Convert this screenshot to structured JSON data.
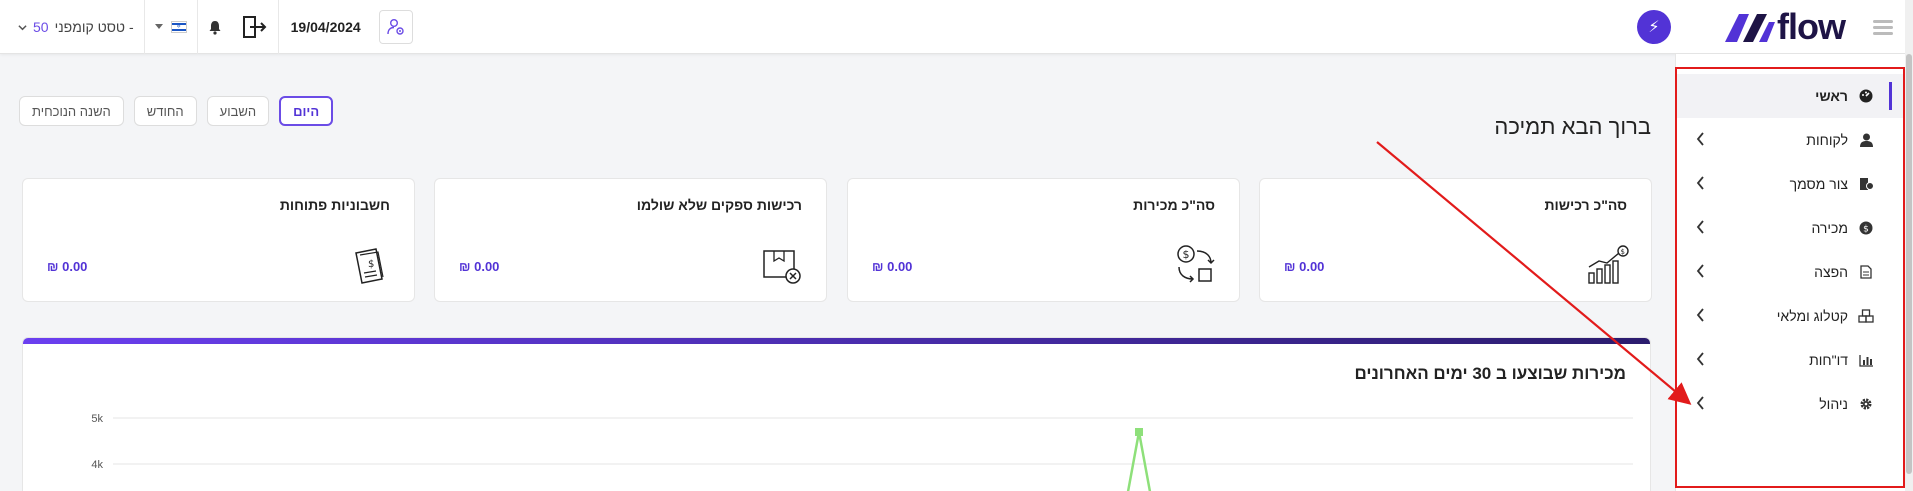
{
  "header": {
    "company_number": "50",
    "company_name": "טסט קומפני -",
    "date": "19/04/2024",
    "logo_text": "flow",
    "icons": [
      "chevron-down-icon",
      "flag-israel-icon",
      "bell-icon",
      "logout-icon",
      "user-settings-icon",
      "bolt-icon",
      "menu-icon"
    ]
  },
  "sidebar": {
    "items": [
      {
        "label": "ראשי",
        "icon": "dashboard-icon",
        "active": true
      },
      {
        "label": "לקוחות",
        "icon": "user-icon"
      },
      {
        "label": "צור מסמך",
        "icon": "document-add-icon"
      },
      {
        "label": "מכירה",
        "icon": "dollar-icon"
      },
      {
        "label": "הפצה",
        "icon": "file-icon"
      },
      {
        "label": "קטלוג ומלאי",
        "icon": "boxes-icon"
      },
      {
        "label": "דו\"חות",
        "icon": "chart-icon"
      },
      {
        "label": "ניהול",
        "icon": "gear-icon"
      }
    ]
  },
  "main": {
    "welcome": "ברוך הבא תמיכה",
    "periods": [
      {
        "label": "השנה הנוכחית"
      },
      {
        "label": "החודש"
      },
      {
        "label": "השבוע"
      },
      {
        "label": "היום",
        "active": true
      }
    ],
    "cards": [
      {
        "title": "חשבוניות פתוחות",
        "value": "0.00 ₪",
        "icon": "invoice-icon"
      },
      {
        "title": "רכישות ספקים שלא שולמו",
        "value": "0.00 ₪",
        "icon": "box-cancel-icon"
      },
      {
        "title": "סה\"כ מכירות",
        "value": "0.00 ₪",
        "icon": "money-exchange-icon"
      },
      {
        "title": "סה\"כ רכישות",
        "value": "0.00 ₪",
        "icon": "growth-chart-icon"
      }
    ],
    "chart_title": "מכירות שבוצעו ב 30 ימים האחרונים"
  },
  "chart_data": {
    "type": "line",
    "title": "מכירות שבוצעו ב 30 ימים האחרונים",
    "yticks": [
      "5k",
      "4k"
    ],
    "ylim": [
      0,
      5000
    ],
    "grid": true,
    "series": [
      {
        "color": "#8ee07a"
      }
    ]
  },
  "colors": {
    "accent": "#5233d6",
    "annotation": "#e21b1b",
    "line": "#8ee07a"
  }
}
